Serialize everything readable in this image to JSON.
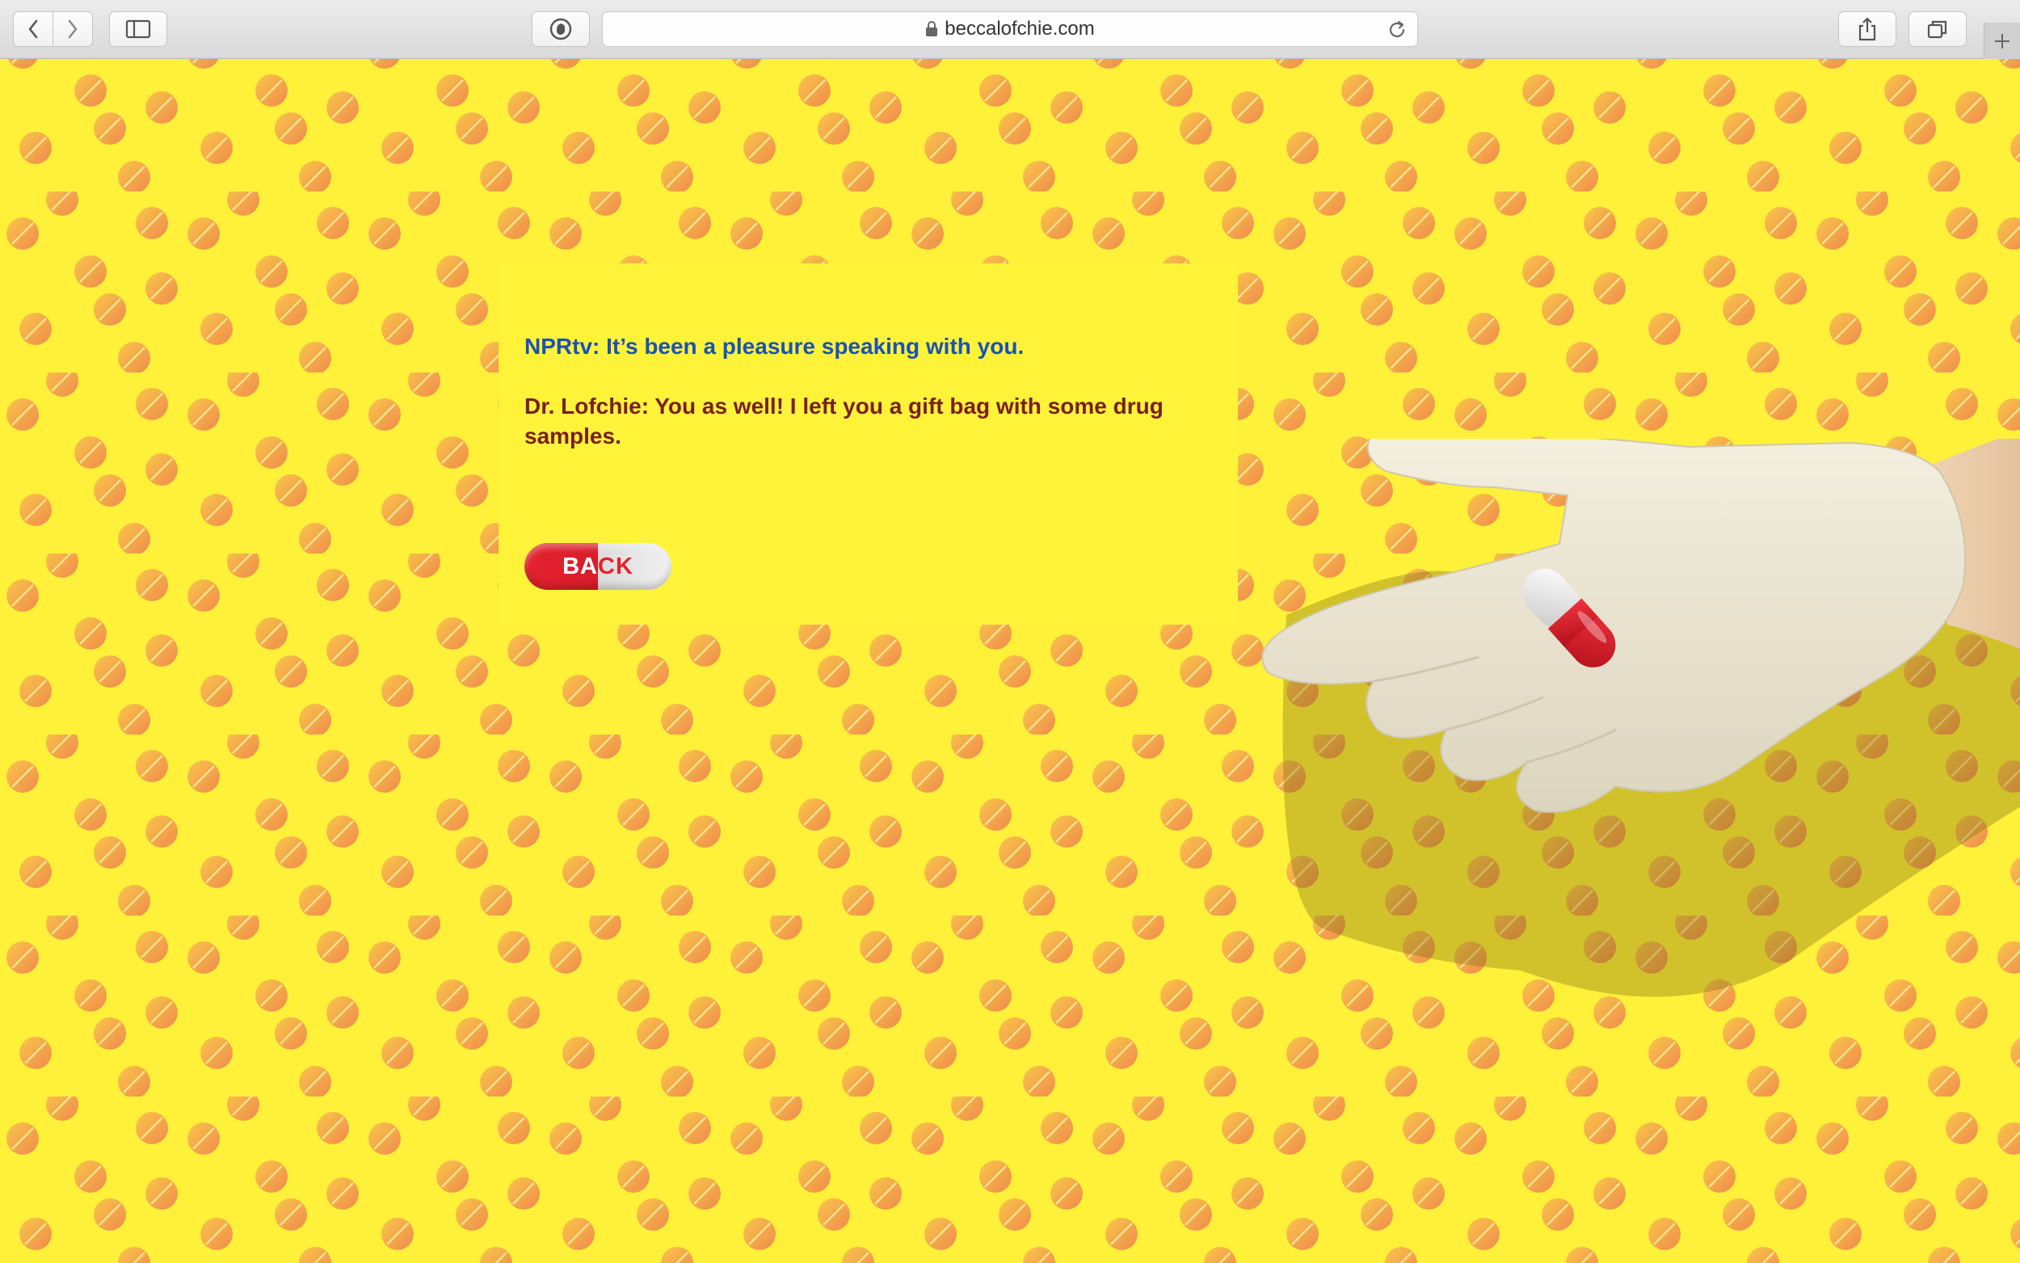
{
  "browser": {
    "url": "beccalofchie.com",
    "icons": [
      "back-icon",
      "forward-icon",
      "sidebar-icon",
      "privacy-shield-icon",
      "lock-icon",
      "reload-icon",
      "share-icon",
      "tabs-icon",
      "new-tab-icon"
    ]
  },
  "page": {
    "background_color": "#fff13a",
    "pill_colors": [
      "#f7b94a",
      "#f08a4b"
    ],
    "dialog": {
      "line_npr": "NPRtv: It’s been a pleasure speaking with you.",
      "line_dr": "Dr. Lofchie: You as well! I left you a gift bag with some drug samples.",
      "back_button": {
        "label_left": "BA",
        "label_right": "CK"
      },
      "colors": {
        "npr": "#1a52b8",
        "doctor": "#7a1f1f",
        "capsule_red": "#e3222f"
      }
    },
    "illustration": {
      "subject": "gloved hand holding red-and-white capsule"
    }
  }
}
